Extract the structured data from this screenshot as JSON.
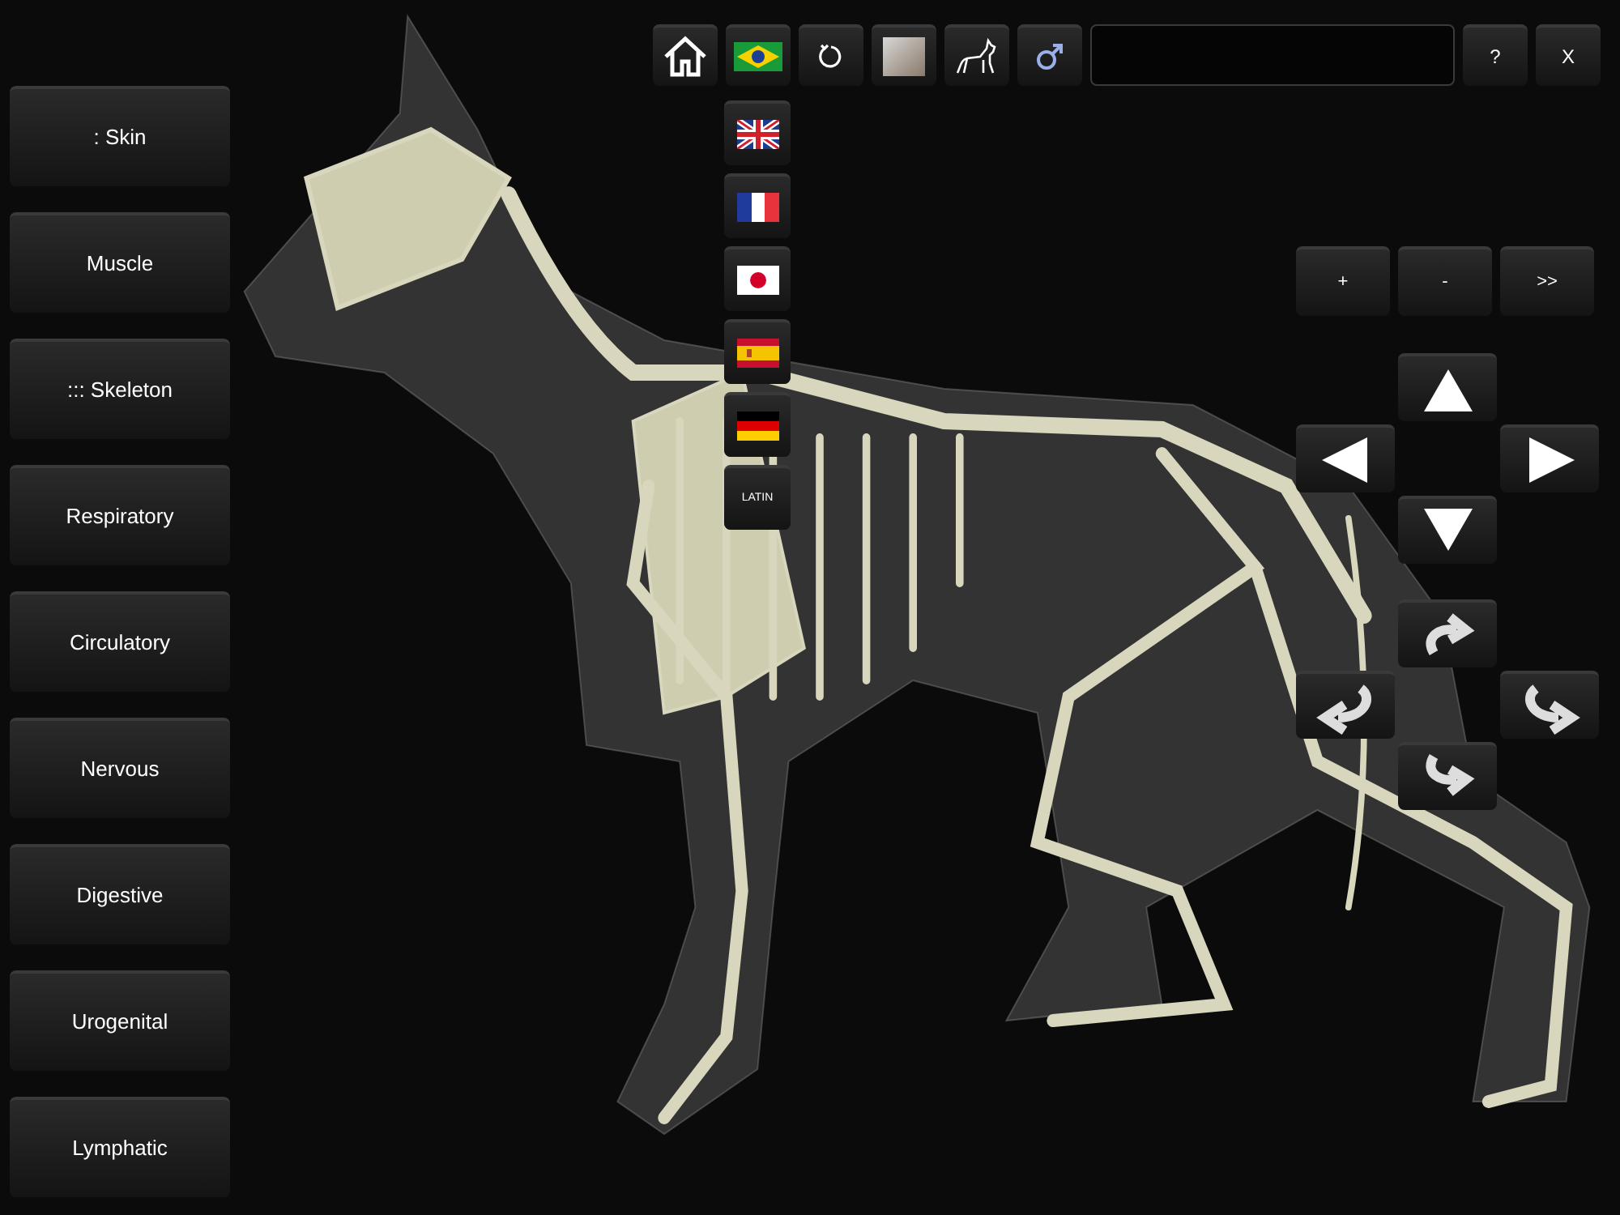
{
  "layers": [
    {
      "label": ": Skin"
    },
    {
      "label": "Muscle"
    },
    {
      "label": "::: Skeleton"
    },
    {
      "label": "Respiratory"
    },
    {
      "label": "Circulatory"
    },
    {
      "label": "Nervous"
    },
    {
      "label": "Digestive"
    },
    {
      "label": "Urogenital"
    },
    {
      "label": "Lymphatic"
    }
  ],
  "toolbar": [
    {
      "kind": "home"
    },
    {
      "kind": "brazil"
    },
    {
      "kind": "reset"
    },
    {
      "kind": "photo"
    },
    {
      "kind": "dog"
    },
    {
      "kind": "male"
    }
  ],
  "help_button": "?",
  "close_button": "X",
  "languages": [
    {
      "kind": "uk"
    },
    {
      "kind": "france"
    },
    {
      "kind": "japan"
    },
    {
      "kind": "spain"
    },
    {
      "kind": "germany"
    },
    {
      "kind": "text",
      "label": "LATIN"
    }
  ],
  "zoom_buttons": [
    "+",
    "-",
    ">>"
  ]
}
